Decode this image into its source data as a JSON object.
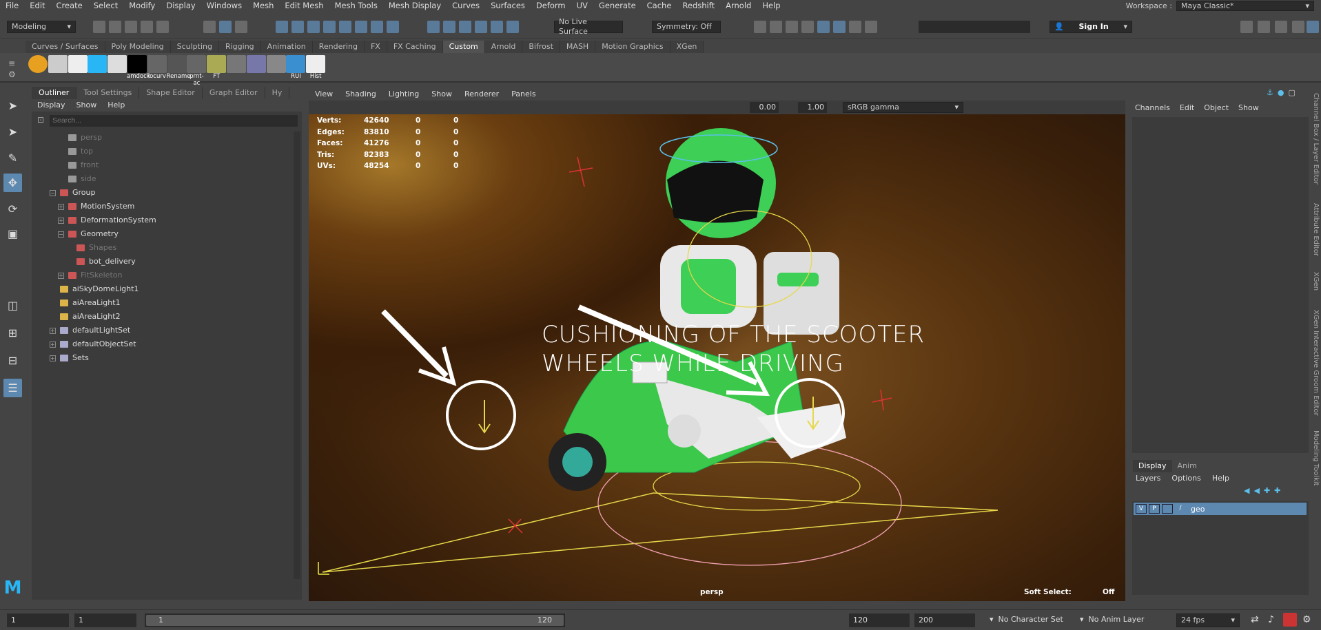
{
  "menubar": [
    "File",
    "Edit",
    "Create",
    "Select",
    "Modify",
    "Display",
    "Windows",
    "Mesh",
    "Edit Mesh",
    "Mesh Tools",
    "Mesh Display",
    "Curves",
    "Surfaces",
    "Deform",
    "UV",
    "Generate",
    "Cache",
    "Redshift",
    "Arnold",
    "Help"
  ],
  "workspace": {
    "label": "Workspace :",
    "value": "Maya Classic*"
  },
  "status": {
    "mode": "Modeling",
    "live_surface": "No Live Surface",
    "symmetry": "Symmetry: Off",
    "sign_in": "Sign In"
  },
  "shelf_tabs": [
    "Curves / Surfaces",
    "Poly Modeling",
    "Sculpting",
    "Rigging",
    "Animation",
    "Rendering",
    "FX",
    "FX Caching",
    "Custom",
    "Arnold",
    "Bifrost",
    "MASH",
    "Motion Graphics",
    "XGen"
  ],
  "shelf_active": "Custom",
  "shelf_buttons": [
    {
      "label": "",
      "icon": "circle-five-icon"
    },
    {
      "label": "",
      "icon": "tpose-icon"
    },
    {
      "label": "",
      "icon": "skull-icon"
    },
    {
      "label": "",
      "icon": "character-blue-icon"
    },
    {
      "label": "",
      "icon": "cube-icon"
    },
    {
      "label": "amdock",
      "icon": "m-logo-icon"
    },
    {
      "label": "locurv",
      "icon": "m-logo-gray-icon"
    },
    {
      "label": "Rename",
      "icon": "rename-icon"
    },
    {
      "label": "prnt-ac",
      "icon": "m-logo-gray-icon"
    },
    {
      "label": "FT",
      "icon": "axis-icon"
    },
    {
      "label": "",
      "icon": "grid-icon"
    },
    {
      "label": "",
      "icon": "film-icon"
    },
    {
      "label": "",
      "icon": "copy-icon"
    },
    {
      "label": "RUI",
      "icon": "rui-icon"
    },
    {
      "label": "Hist",
      "icon": "hist-icon"
    }
  ],
  "outliner": {
    "tabs": [
      "Outliner",
      "Tool Settings",
      "Shape Editor",
      "Graph Editor",
      "Hy"
    ],
    "menu": [
      "Display",
      "Show",
      "Help"
    ],
    "search_placeholder": "Search...",
    "items": [
      {
        "label": "persp",
        "dim": true,
        "indent": 1
      },
      {
        "label": "top",
        "dim": true,
        "indent": 1
      },
      {
        "label": "front",
        "dim": true,
        "indent": 1
      },
      {
        "label": "side",
        "dim": true,
        "indent": 1
      },
      {
        "label": "Group",
        "dim": false,
        "indent": 0
      },
      {
        "label": "MotionSystem",
        "dim": false,
        "indent": 1
      },
      {
        "label": "DeformationSystem",
        "dim": false,
        "indent": 1
      },
      {
        "label": "Geometry",
        "dim": false,
        "indent": 1
      },
      {
        "label": "Shapes",
        "dim": true,
        "indent": 2
      },
      {
        "label": "bot_delivery",
        "dim": false,
        "indent": 2
      },
      {
        "label": "FitSkeleton",
        "dim": true,
        "indent": 1
      },
      {
        "label": "aiSkyDomeLight1",
        "dim": false,
        "indent": 0
      },
      {
        "label": "aiAreaLight1",
        "dim": false,
        "indent": 0
      },
      {
        "label": "aiAreaLight2",
        "dim": false,
        "indent": 0
      },
      {
        "label": "defaultLightSet",
        "dim": false,
        "indent": 0
      },
      {
        "label": "defaultObjectSet",
        "dim": false,
        "indent": 0
      },
      {
        "label": "Sets",
        "dim": false,
        "indent": 0
      }
    ]
  },
  "viewport": {
    "menu": [
      "View",
      "Shading",
      "Lighting",
      "Show",
      "Renderer",
      "Panels"
    ],
    "exposure": "0.00",
    "gamma": "1.00",
    "colorspace": "sRGB gamma",
    "hud": [
      {
        "label": "Verts:",
        "v": "42640",
        "a": "0",
        "b": "0"
      },
      {
        "label": "Edges:",
        "v": "83810",
        "a": "0",
        "b": "0"
      },
      {
        "label": "Faces:",
        "v": "41276",
        "a": "0",
        "b": "0"
      },
      {
        "label": "Tris:",
        "v": "82383",
        "a": "0",
        "b": "0"
      },
      {
        "label": "UVs:",
        "v": "48254",
        "a": "0",
        "b": "0"
      }
    ],
    "annotation_line1": "CUSHIONING OF THE SCOOTER",
    "annotation_line2": "WHEELS WHILE DRIVING",
    "camera": "persp",
    "soft_select_label": "Soft Select:",
    "soft_select_value": "Off"
  },
  "channelbox": {
    "menu": [
      "Channels",
      "Edit",
      "Object",
      "Show"
    ]
  },
  "layers": {
    "tabs": [
      "Display",
      "Anim"
    ],
    "menu": [
      "Layers",
      "Options",
      "Help"
    ],
    "layer": {
      "v": "V",
      "p": "P",
      "name": "geo"
    }
  },
  "sidebar_tabs": [
    "Channel Box / Layer Editor",
    "Attribute Editor",
    "XGen",
    "XGen Interactive Groom Editor",
    "Modeling Toolkit"
  ],
  "timeline": {
    "start": "1",
    "cur": "1",
    "range_start": "1",
    "range_end": "120",
    "end": "120",
    "max": "200",
    "char_set": "No Character Set",
    "anim_layer": "No Anim Layer",
    "fps": "24 fps"
  }
}
